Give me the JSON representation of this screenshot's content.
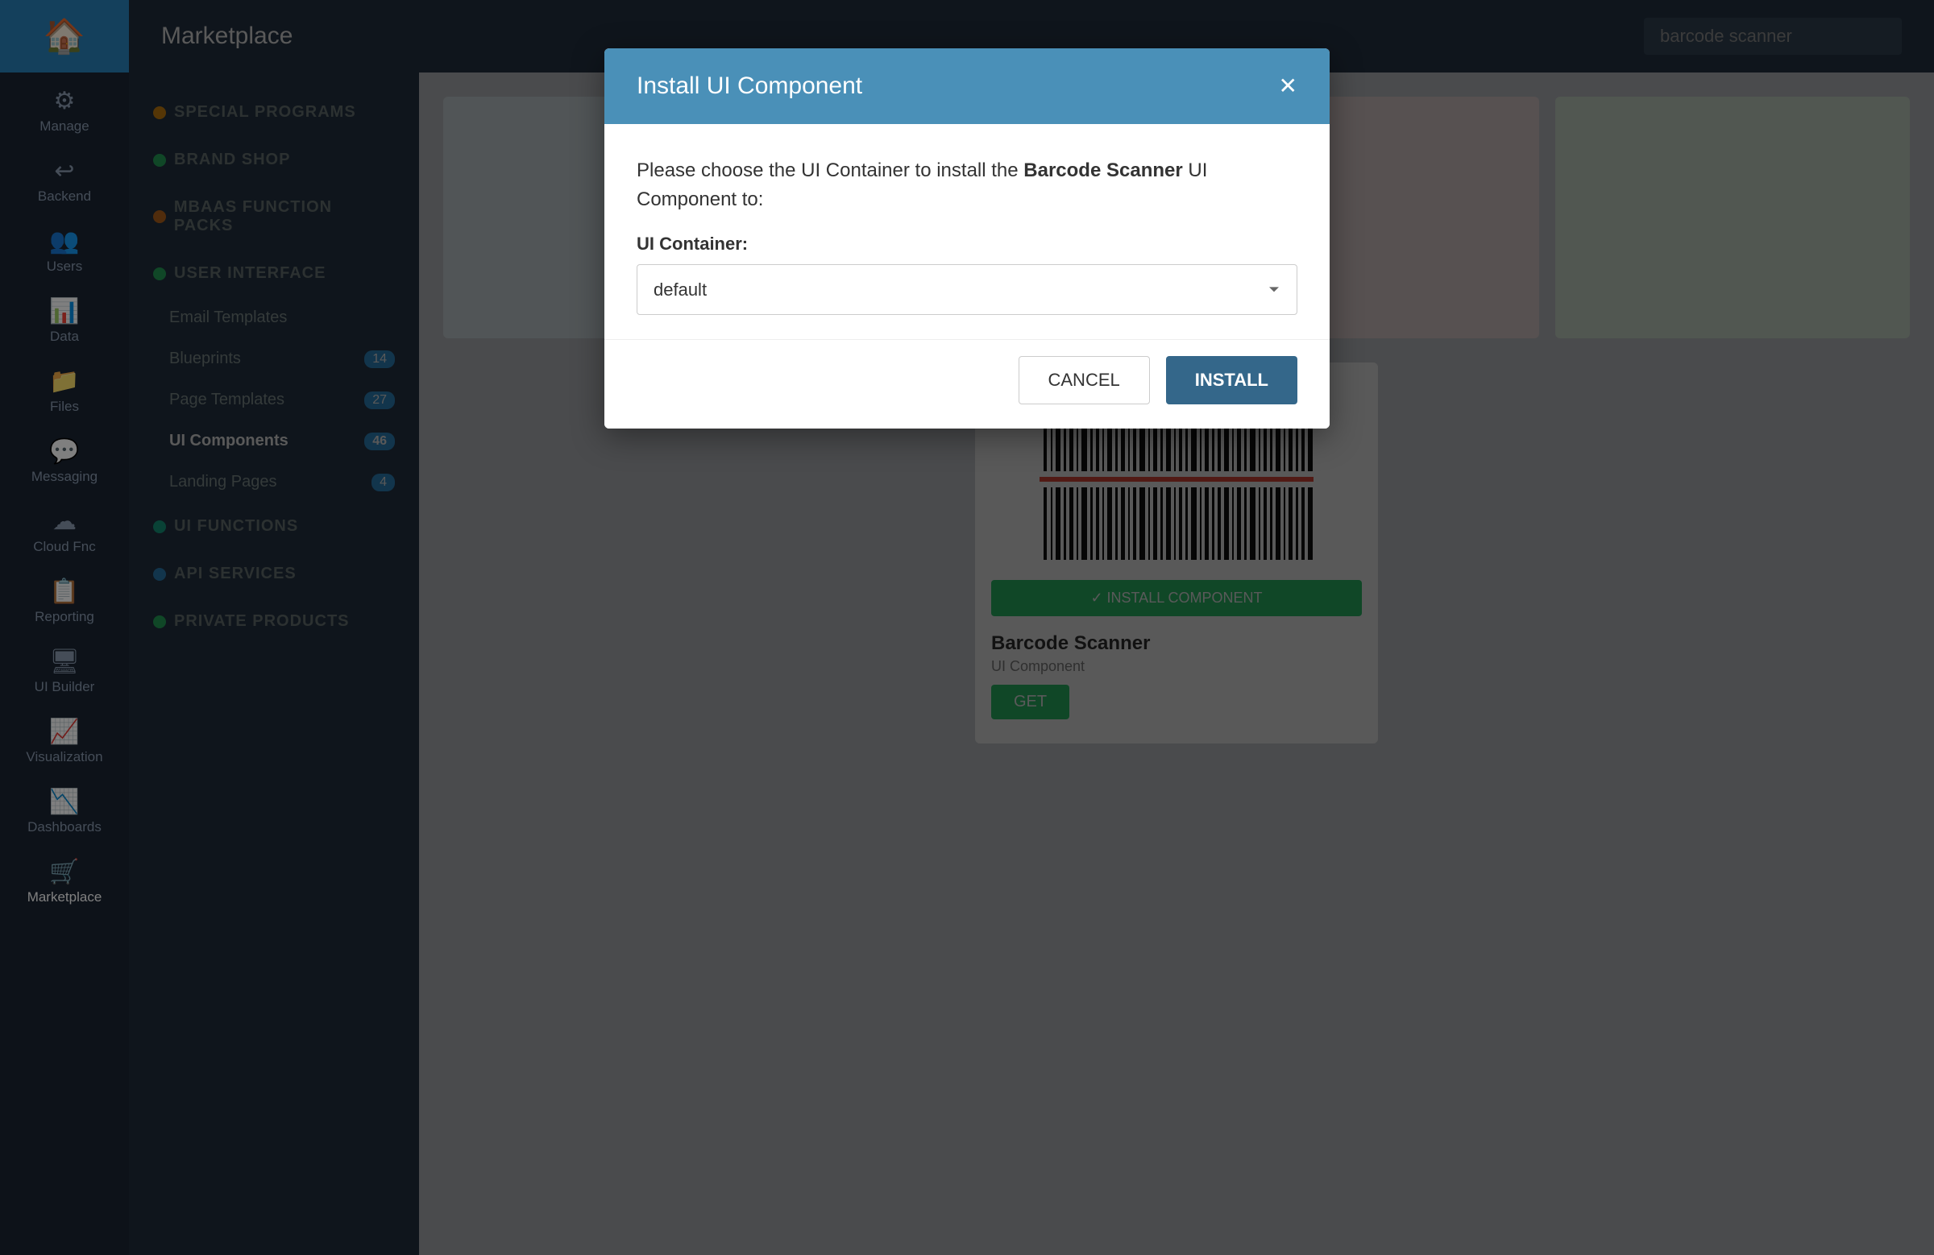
{
  "sidebar": {
    "logo_icon": "🏠",
    "items": [
      {
        "id": "manage",
        "icon": "⚙",
        "label": "Manage"
      },
      {
        "id": "backend",
        "icon": "↩",
        "label": "Backend"
      },
      {
        "id": "users",
        "icon": "👥",
        "label": "Users"
      },
      {
        "id": "data",
        "icon": "📊",
        "label": "Data"
      },
      {
        "id": "files",
        "icon": "📁",
        "label": "Files"
      },
      {
        "id": "messaging",
        "icon": "💬",
        "label": "Messaging"
      },
      {
        "id": "cloud",
        "icon": "☁",
        "label": "Cloud Fnc"
      },
      {
        "id": "reporting",
        "icon": "📋",
        "label": "Reporting"
      },
      {
        "id": "ui_builder",
        "icon": "🖥",
        "label": "UI Builder"
      },
      {
        "id": "visualization",
        "icon": "📈",
        "label": "Visualization"
      },
      {
        "id": "dashboards",
        "icon": "📉",
        "label": "Dashboards"
      },
      {
        "id": "marketplace",
        "icon": "🛒",
        "label": "Marketplace",
        "active": true
      }
    ]
  },
  "topbar": {
    "title": "Marketplace",
    "search_placeholder": "barcode scanner"
  },
  "sub_sidebar": {
    "sections": [
      {
        "id": "special_programs",
        "label": "SPECIAL PROGRAMS",
        "color": "#f39c12",
        "items": []
      },
      {
        "id": "brand_shop",
        "label": "BRAND SHOP",
        "color": "#2ecc71",
        "items": []
      },
      {
        "id": "mbaas_function_packs",
        "label": "MBAAS FUNCTION PACKS",
        "color": "#e67e22",
        "items": []
      },
      {
        "id": "user_interface",
        "label": "USER INTERFACE",
        "color": "#2ecc71",
        "items": [
          {
            "label": "Email Templates",
            "badge": ""
          },
          {
            "label": "Blueprints",
            "badge": "14"
          },
          {
            "label": "Page Templates",
            "badge": "27"
          },
          {
            "label": "UI Components",
            "badge": "46",
            "active": true
          },
          {
            "label": "Landing Pages",
            "badge": "4"
          }
        ]
      },
      {
        "id": "ui_functions",
        "label": "UI FUNCTIONS",
        "color": "#1abc9c",
        "items": []
      },
      {
        "id": "api_services",
        "label": "API SERVICES",
        "color": "#3498db",
        "items": []
      },
      {
        "id": "private_products",
        "label": "PRIVATE PRODUCTS",
        "color": "#2ecc71",
        "items": []
      }
    ]
  },
  "dialog": {
    "title": "Install UI Component",
    "description_prefix": "Please choose the UI Container to install the ",
    "component_name": "Barcode Scanner",
    "description_suffix": " UI Component to:",
    "container_label": "UI Container:",
    "container_default": "default",
    "cancel_label": "CANCEL",
    "install_label": "INSTALL",
    "close_icon": "✕"
  },
  "background_card": {
    "item_name": "Barcode Scanner",
    "item_type": "UI Component",
    "get_label": "GET"
  }
}
